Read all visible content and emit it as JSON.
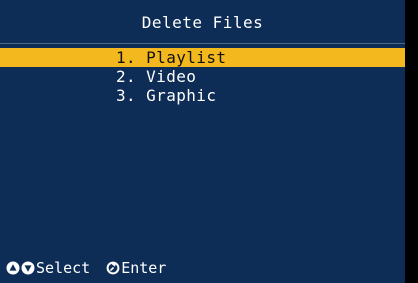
{
  "screen": {
    "title": "Delete Files",
    "menu": {
      "items": [
        {
          "number": "1.",
          "label": "Playlist",
          "selected": true
        },
        {
          "number": "2.",
          "label": "Video",
          "selected": false
        },
        {
          "number": "3.",
          "label": "Graphic",
          "selected": false
        }
      ]
    },
    "footer": {
      "select_label": "Select",
      "enter_label": "Enter",
      "icons": [
        "up-arrow-circle-icon",
        "down-arrow-circle-icon",
        "enter-circle-icon"
      ]
    }
  },
  "colors": {
    "background": "#0d2d56",
    "highlight": "#f2b81d",
    "text": "#ffffff",
    "selected_text": "#111111"
  }
}
